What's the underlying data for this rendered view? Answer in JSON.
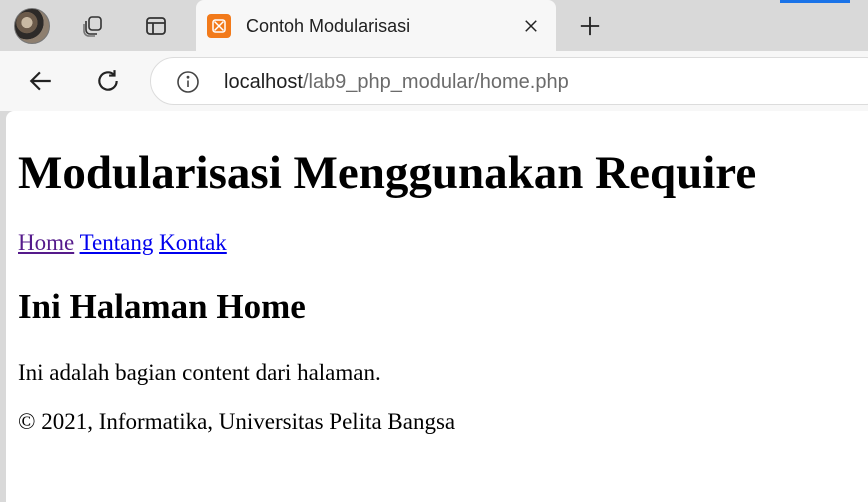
{
  "browser": {
    "tab": {
      "title": "Contoh Modularisasi",
      "favicon": "xampp-icon"
    },
    "address": {
      "host": "localhost",
      "path": "/lab9_php_modular/home.php"
    },
    "icons": {
      "workspaces": "workspaces-icon",
      "tab_actions": "tab-actions-icon",
      "close": "close-icon",
      "new_tab": "plus-icon",
      "back": "back-arrow-icon",
      "refresh": "refresh-icon",
      "info": "info-icon"
    },
    "colors": {
      "favicon": "#f27a1a",
      "link": "#0000ee",
      "visited_link": "#551a8b"
    }
  },
  "page": {
    "heading": "Modularisasi Menggunakan Require",
    "nav": [
      {
        "label": "Home",
        "visited": true
      },
      {
        "label": "Tentang",
        "visited": false
      },
      {
        "label": "Kontak",
        "visited": false
      }
    ],
    "subheading": "Ini Halaman Home",
    "content": "Ini adalah bagian content dari halaman.",
    "footer": "© 2021, Informatika, Universitas Pelita Bangsa"
  }
}
